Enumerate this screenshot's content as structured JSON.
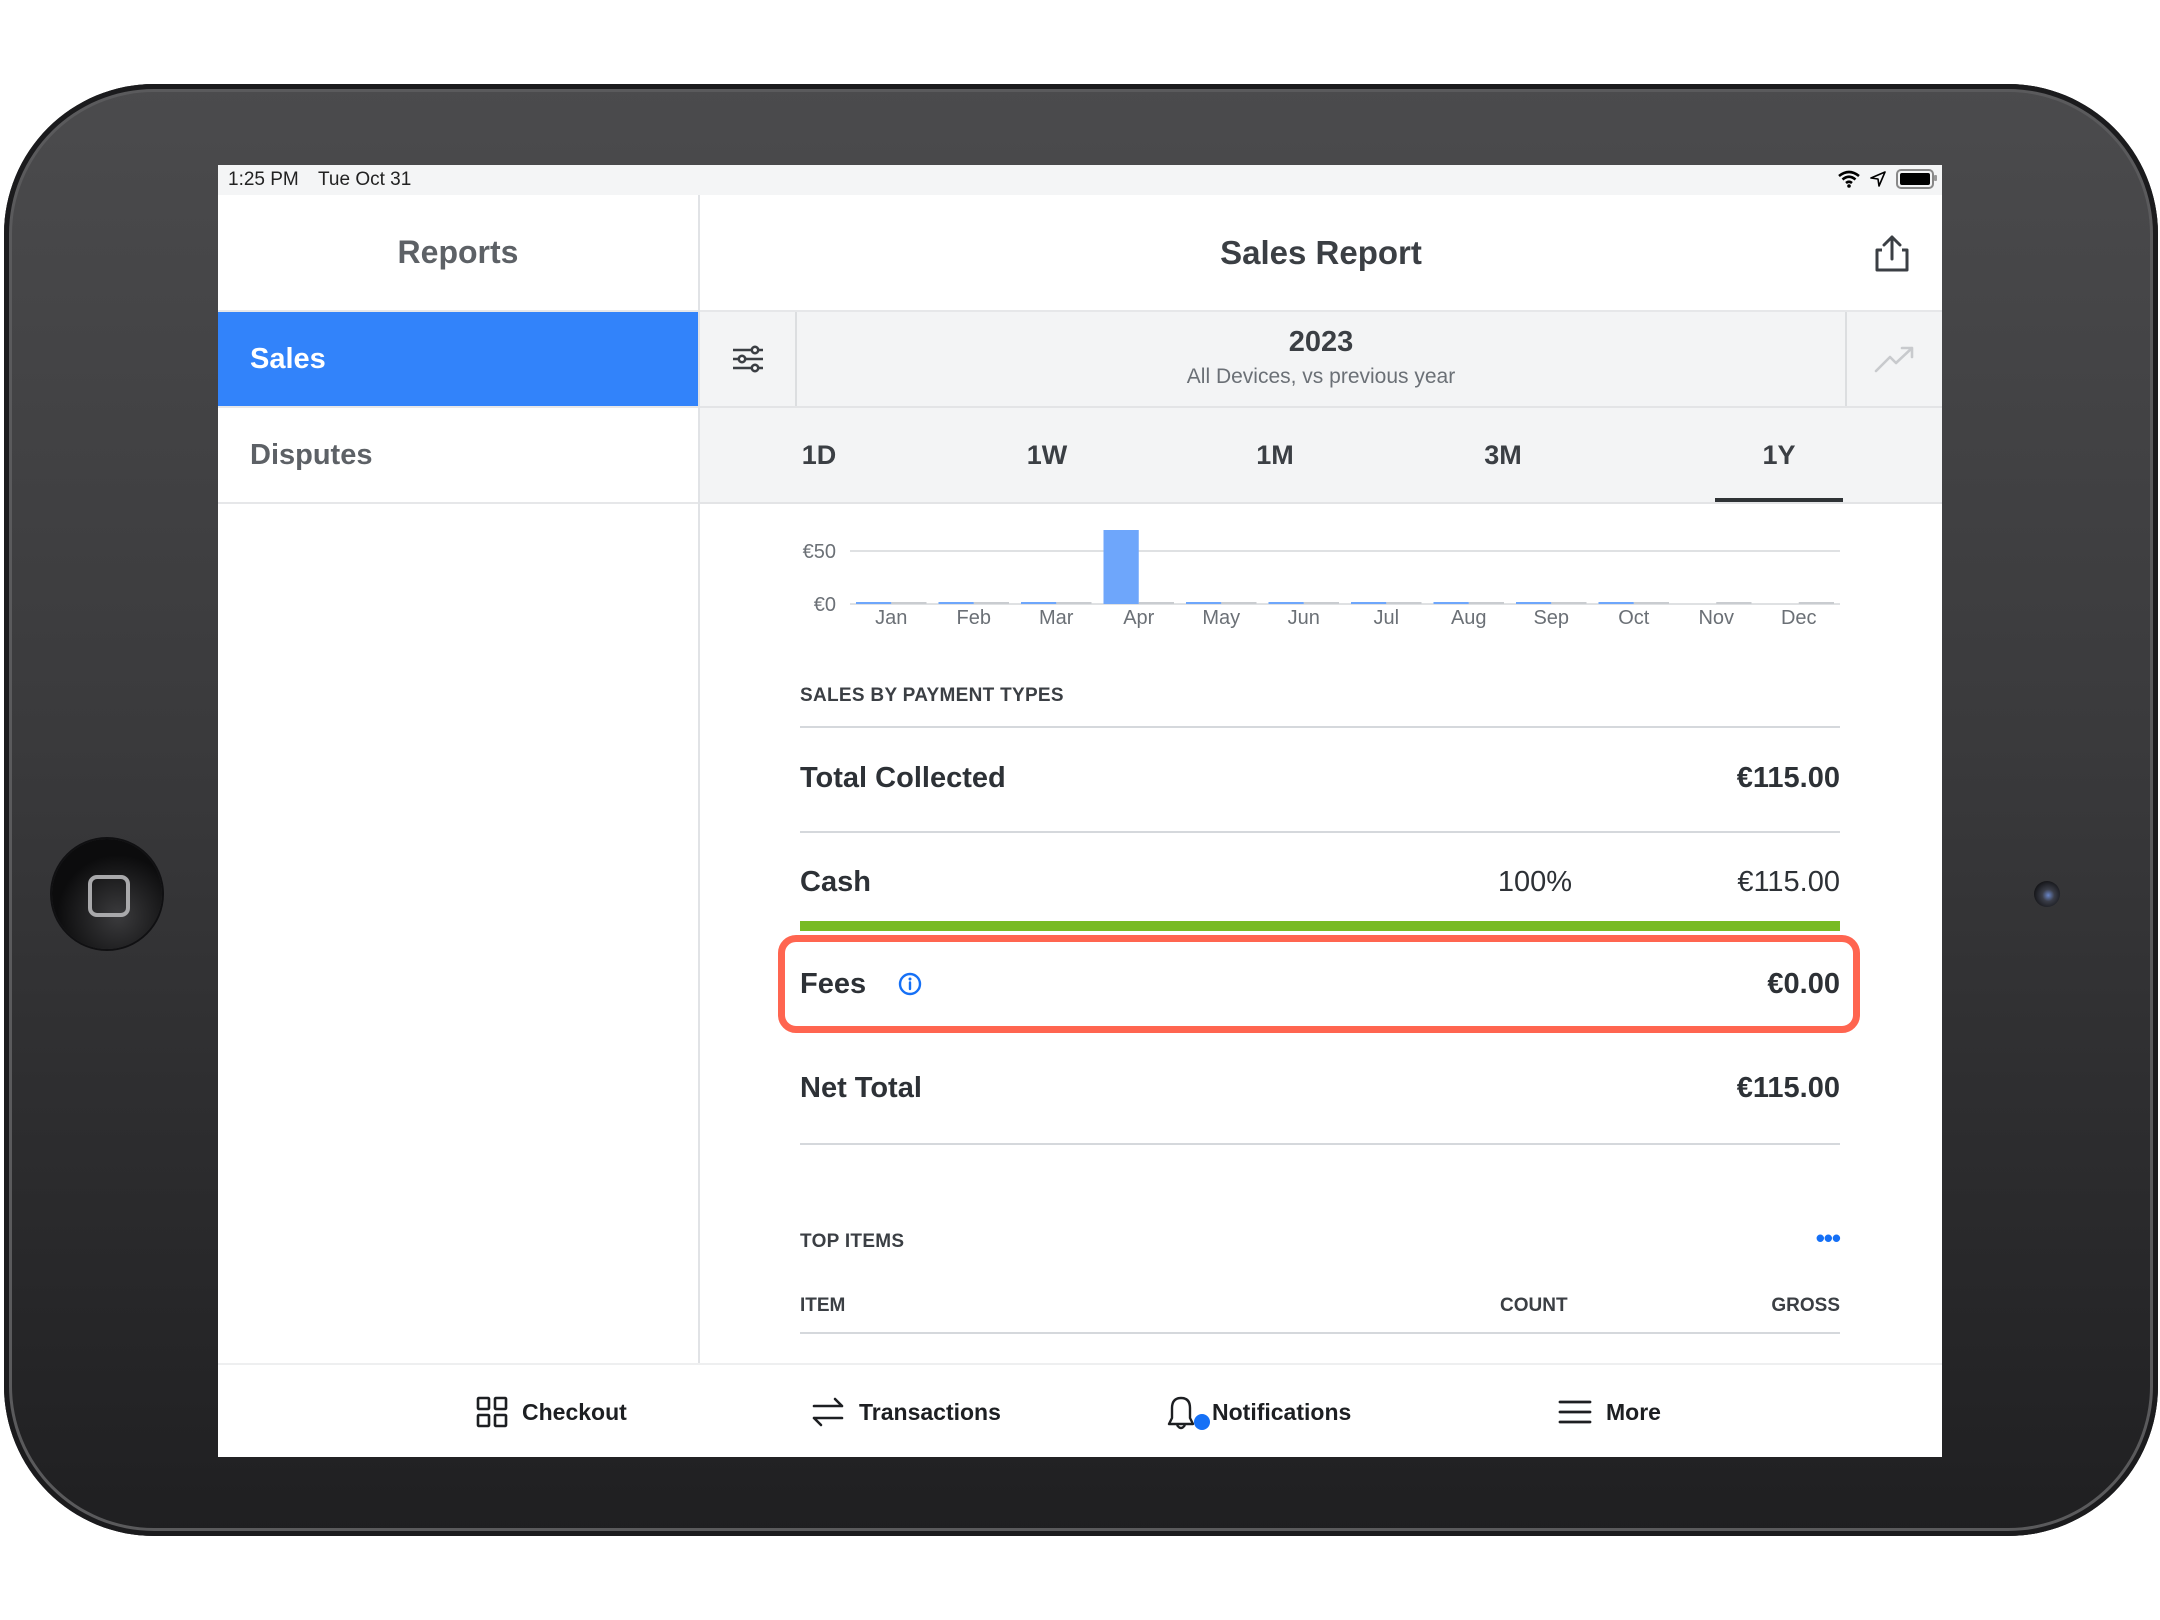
{
  "status_bar": {
    "time": "1:25 PM",
    "date": "Tue Oct 31",
    "icons": [
      "wifi-icon",
      "location-arrow-icon",
      "battery-icon"
    ]
  },
  "sidebar": {
    "title": "Reports",
    "items": [
      {
        "label": "Sales",
        "active": true
      },
      {
        "label": "Disputes",
        "active": false
      }
    ]
  },
  "header": {
    "title": "Sales Report",
    "share_icon": "share-icon"
  },
  "date_selector": {
    "year": "2023",
    "subtitle": "All Devices, vs previous year",
    "filter_icon": "sliders-icon",
    "trend_icon": "trend-up-icon"
  },
  "range_tabs": [
    {
      "label": "1D",
      "active": false
    },
    {
      "label": "1W",
      "active": false
    },
    {
      "label": "1M",
      "active": false
    },
    {
      "label": "3M",
      "active": false
    },
    {
      "label": "1Y",
      "active": true
    }
  ],
  "chart_data": {
    "type": "bar",
    "title": "",
    "xlabel": "",
    "ylabel": "",
    "categories": [
      "Jan",
      "Feb",
      "Mar",
      "Apr",
      "May",
      "Jun",
      "Jul",
      "Aug",
      "Sep",
      "Oct",
      "Nov",
      "Dec"
    ],
    "series": [
      {
        "name": "2023",
        "color": "#6ea6fb",
        "values": [
          0,
          0,
          0,
          115,
          0,
          0,
          0,
          0,
          0,
          0,
          null,
          null
        ]
      },
      {
        "name": "Previous year",
        "color": "#c9ccd0",
        "values": [
          0,
          0,
          0,
          0,
          0,
          0,
          0,
          0,
          0,
          0,
          0,
          0
        ]
      }
    ],
    "y_ticks": [
      "€0",
      "€50"
    ],
    "y_tick_values": [
      0,
      50
    ],
    "ylim": [
      0,
      65
    ],
    "grid": true,
    "legend": "none"
  },
  "payment_types": {
    "section_title": "SALES BY PAYMENT TYPES",
    "total_collected": {
      "label": "Total Collected",
      "value": "€115.00"
    },
    "cash": {
      "label": "Cash",
      "percent": "100%",
      "value": "€115.00",
      "fill_fraction": 1.0,
      "color": "#78bb24"
    },
    "fees": {
      "label": "Fees",
      "value": "€0.00",
      "info_icon": "info-icon",
      "highlighted": true
    },
    "net_total": {
      "label": "Net Total",
      "value": "€115.00"
    }
  },
  "top_items": {
    "section_title": "TOP ITEMS",
    "more_label": "•••",
    "columns": [
      "ITEM",
      "COUNT",
      "GROSS"
    ]
  },
  "tab_bar": [
    {
      "label": "Checkout",
      "icon": "grid-icon"
    },
    {
      "label": "Transactions",
      "icon": "swap-arrows-icon"
    },
    {
      "label": "Notifications",
      "icon": "bell-icon",
      "badge": true
    },
    {
      "label": "More",
      "icon": "menu-icon"
    }
  ],
  "colors": {
    "accent": "#3283fa",
    "highlight": "#ff6550",
    "cash": "#78bb24",
    "link": "#1570f6"
  }
}
